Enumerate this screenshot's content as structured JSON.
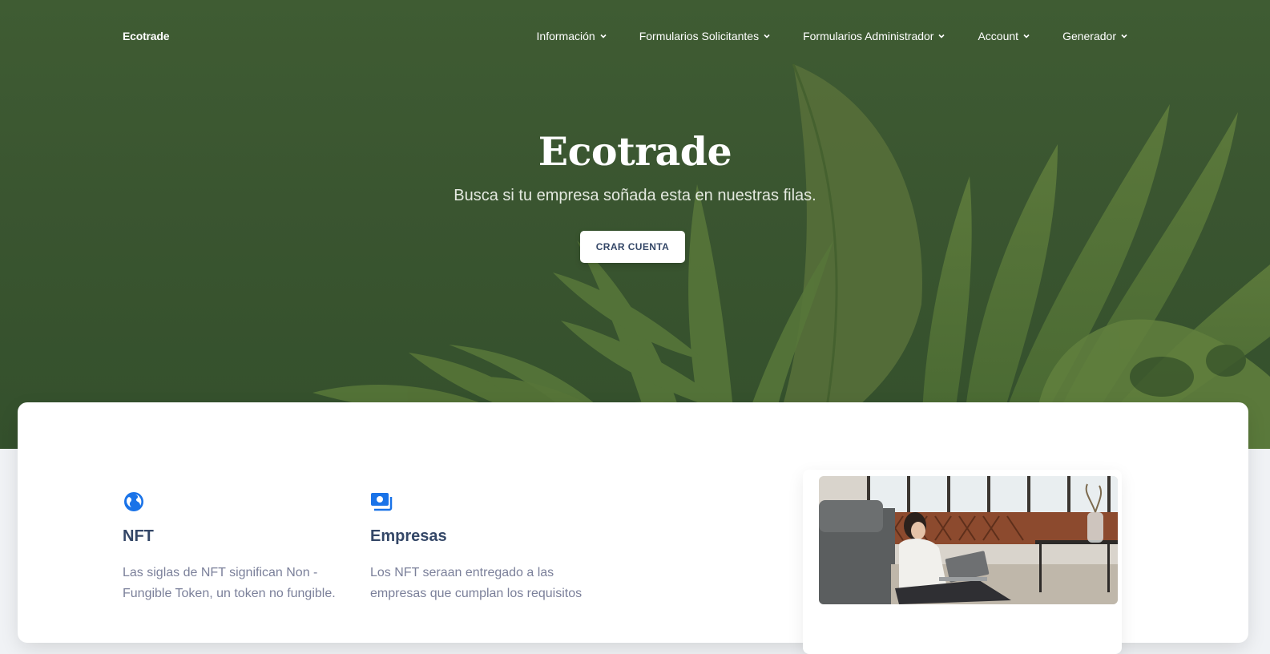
{
  "nav": {
    "brand": "Ecotrade",
    "items": [
      {
        "label": "Información"
      },
      {
        "label": "Formularios Solicitantes"
      },
      {
        "label": "Formularios Administrador"
      },
      {
        "label": "Account"
      },
      {
        "label": "Generador"
      }
    ]
  },
  "hero": {
    "title": "Ecotrade",
    "subtitle": "Busca si tu empresa soñada esta en nuestras filas.",
    "cta_label": "CRAR CUENTA"
  },
  "features": [
    {
      "icon": "globe-icon",
      "title": "NFT",
      "text": "Las siglas de NFT significan Non - Fungible Token, un token no fungible."
    },
    {
      "icon": "money-icon",
      "title": "Empresas",
      "text": "Los NFT seraan entregado a las empresas que cumplan los requisitos"
    }
  ],
  "colors": {
    "hero_green": "#3a5530",
    "accent_blue": "#1a73e8",
    "heading": "#344767",
    "body_text": "#7b809a"
  }
}
